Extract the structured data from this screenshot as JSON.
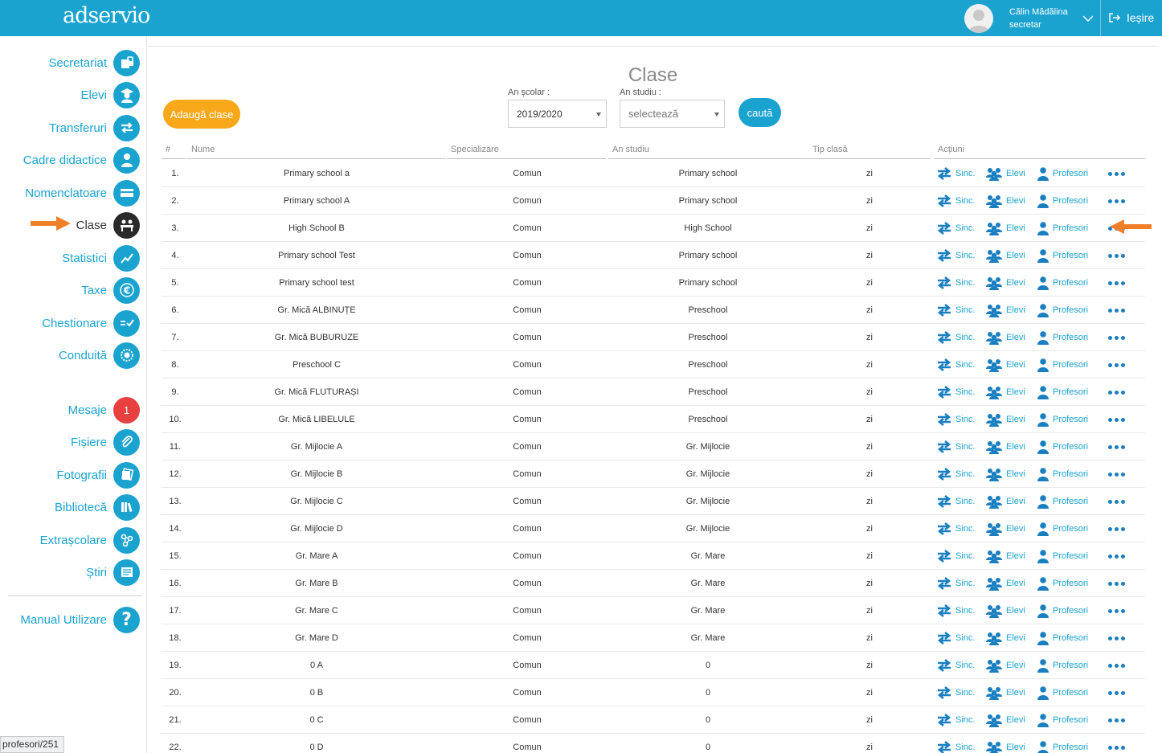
{
  "header": {
    "logo": "adservio",
    "user_name": "Călin Mădălina",
    "user_role": "secretar",
    "logout_label": "Ieșire"
  },
  "sidebar": {
    "items": [
      {
        "label": "Secretariat",
        "icon": "lock-document-icon"
      },
      {
        "label": "Elevi",
        "icon": "graduate-icon"
      },
      {
        "label": "Transferuri",
        "icon": "transfer-arrows-icon"
      },
      {
        "label": "Cadre didactice",
        "icon": "teacher-icon"
      },
      {
        "label": "Nomenclatoare",
        "icon": "card-icon"
      },
      {
        "label": "Clase",
        "icon": "classroom-icon",
        "active": true
      },
      {
        "label": "Statistici",
        "icon": "chart-line-icon"
      },
      {
        "label": "Taxe",
        "icon": "euro-icon"
      },
      {
        "label": "Chestionare",
        "icon": "checklist-icon"
      },
      {
        "label": "Conduită",
        "icon": "badge-icon"
      },
      {
        "label": "Mesaje",
        "icon": "messages-badge",
        "badge": "1"
      },
      {
        "label": "Fișiere",
        "icon": "paperclip-icon"
      },
      {
        "label": "Fotografii",
        "icon": "photos-icon"
      },
      {
        "label": "Bibliotecă",
        "icon": "books-icon"
      },
      {
        "label": "Extrașcolare",
        "icon": "activities-icon"
      },
      {
        "label": "Știri",
        "icon": "news-icon"
      },
      {
        "label": "Manual Utilizare",
        "icon": "help-icon"
      }
    ]
  },
  "status_url": "profesori/251",
  "main": {
    "title": "Clase",
    "add_button": "Adaugă clase",
    "filters": {
      "school_year_label": "An școlar :",
      "school_year_value": "2019/2020",
      "study_year_label": "An studiu :",
      "study_year_value": "selectează",
      "search_button": "caută"
    },
    "columns": [
      "#",
      "Nume",
      "Specializare",
      "An studiu",
      "Tip clasă",
      "Acțiuni"
    ],
    "actions": {
      "sinc": "Sinc.",
      "elevi": "Elevi",
      "profesori": "Profesori"
    },
    "rows": [
      {
        "num": "1.",
        "name": "Primary school a",
        "spec": "Comun",
        "study": "Primary school",
        "tip": "zi"
      },
      {
        "num": "2.",
        "name": "Primary school A",
        "spec": "Comun",
        "study": "Primary school",
        "tip": "zi"
      },
      {
        "num": "3.",
        "name": "High School B",
        "spec": "Comun",
        "study": "High School",
        "tip": "zi"
      },
      {
        "num": "4.",
        "name": "Primary school Test",
        "spec": "Comun",
        "study": "Primary school",
        "tip": "zi"
      },
      {
        "num": "5.",
        "name": "Primary school test",
        "spec": "Comun",
        "study": "Primary school",
        "tip": "zi"
      },
      {
        "num": "6.",
        "name": "Gr. Mică ALBINUȚE",
        "spec": "Comun",
        "study": "Preschool",
        "tip": "zi"
      },
      {
        "num": "7.",
        "name": "Gr. Mică BUBURUZE",
        "spec": "Comun",
        "study": "Preschool",
        "tip": "zi"
      },
      {
        "num": "8.",
        "name": "Preschool C",
        "spec": "Comun",
        "study": "Preschool",
        "tip": "zi"
      },
      {
        "num": "9.",
        "name": "Gr. Mică FLUTURAȘI",
        "spec": "Comun",
        "study": "Preschool",
        "tip": "zi"
      },
      {
        "num": "10.",
        "name": "Gr. Mică LIBELULE",
        "spec": "Comun",
        "study": "Preschool",
        "tip": "zi"
      },
      {
        "num": "11.",
        "name": "Gr. Mijlocie A",
        "spec": "Comun",
        "study": "Gr. Mijlocie",
        "tip": "zi"
      },
      {
        "num": "12.",
        "name": "Gr. Mijlocie B",
        "spec": "Comun",
        "study": "Gr. Mijlocie",
        "tip": "zi"
      },
      {
        "num": "13.",
        "name": "Gr. Mijlocie C",
        "spec": "Comun",
        "study": "Gr. Mijlocie",
        "tip": "zi"
      },
      {
        "num": "14.",
        "name": "Gr. Mijlocie D",
        "spec": "Comun",
        "study": "Gr. Mijlocie",
        "tip": "zi"
      },
      {
        "num": "15.",
        "name": "Gr. Mare A",
        "spec": "Comun",
        "study": "Gr. Mare",
        "tip": "zi"
      },
      {
        "num": "16.",
        "name": "Gr. Mare B",
        "spec": "Comun",
        "study": "Gr. Mare",
        "tip": "zi"
      },
      {
        "num": "17.",
        "name": "Gr. Mare C",
        "spec": "Comun",
        "study": "Gr. Mare",
        "tip": "zi"
      },
      {
        "num": "18.",
        "name": "Gr. Mare D",
        "spec": "Comun",
        "study": "Gr. Mare",
        "tip": "zi"
      },
      {
        "num": "19.",
        "name": "0 A",
        "spec": "Comun",
        "study": "0",
        "tip": "zi"
      },
      {
        "num": "20.",
        "name": "0 B",
        "spec": "Comun",
        "study": "0",
        "tip": "zi"
      },
      {
        "num": "21.",
        "name": "0 C",
        "spec": "Comun",
        "study": "0",
        "tip": "zi"
      },
      {
        "num": "22.",
        "name": "0 D",
        "spec": "Comun",
        "study": "0",
        "tip": "zi"
      }
    ]
  },
  "colors": {
    "primary": "#1ba3d0",
    "accent": "#f9a81a",
    "badge": "#e8403e",
    "annotation_arrow": "#f07f2a"
  }
}
